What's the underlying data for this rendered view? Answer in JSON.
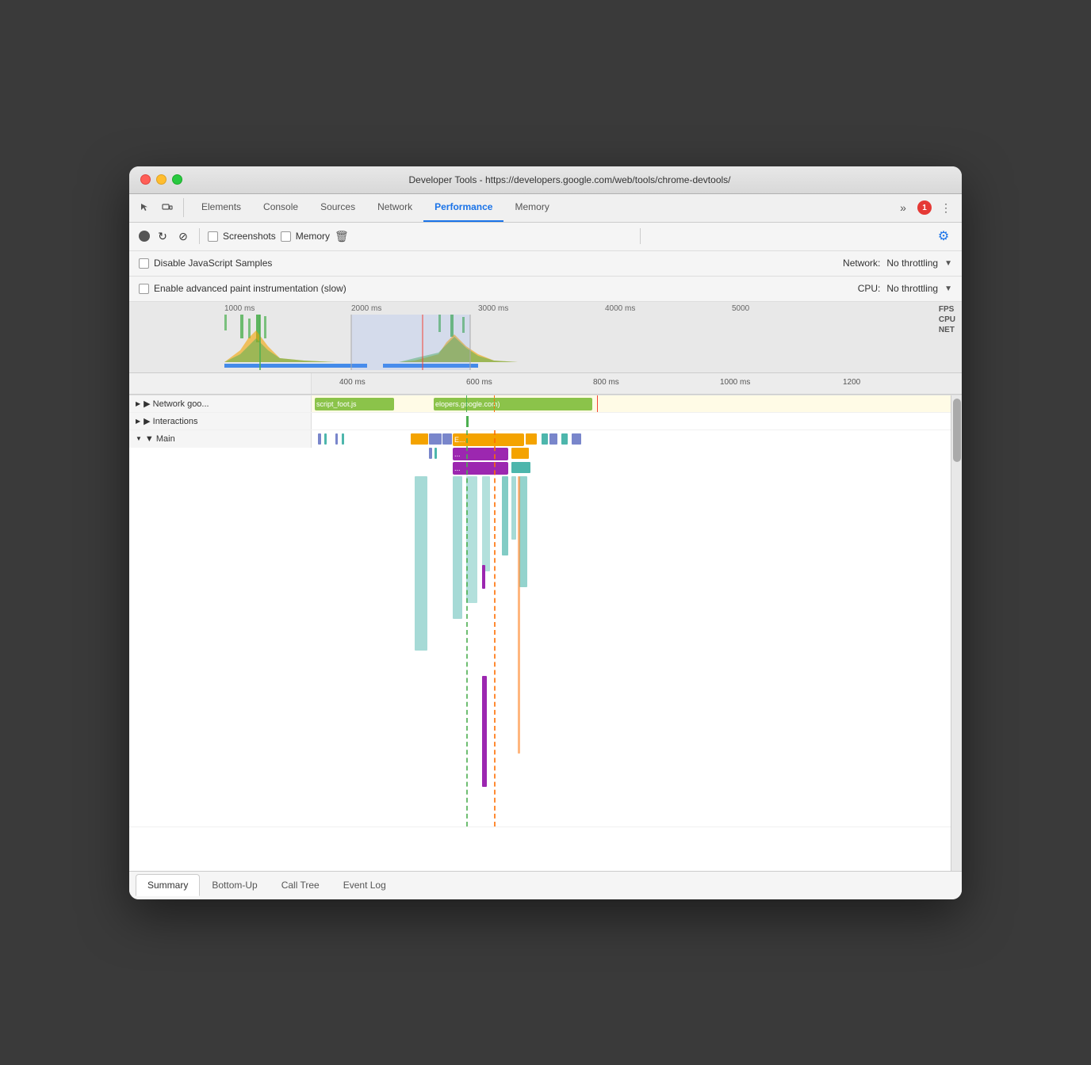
{
  "window": {
    "title": "Developer Tools - https://developers.google.com/web/tools/chrome-devtools/"
  },
  "tabs": {
    "items": [
      {
        "label": "Elements",
        "active": false
      },
      {
        "label": "Console",
        "active": false
      },
      {
        "label": "Sources",
        "active": false
      },
      {
        "label": "Network",
        "active": false
      },
      {
        "label": "Performance",
        "active": true
      },
      {
        "label": "Memory",
        "active": false
      }
    ],
    "error_count": "1"
  },
  "toolbar": {
    "screenshots_label": "Screenshots",
    "memory_label": "Memory"
  },
  "settings": {
    "disable_js_samples": "Disable JavaScript Samples",
    "enable_paint": "Enable advanced paint instrumentation (slow)",
    "network_label": "Network:",
    "network_value": "No throttling",
    "cpu_label": "CPU:",
    "cpu_value": "No throttling"
  },
  "timeline": {
    "overview_marks": [
      "1000 ms",
      "2000 ms",
      "3000 ms",
      "4000 ms",
      "5000"
    ],
    "detail_marks": [
      "400 ms",
      "600 ms",
      "800 ms",
      "1000 ms",
      "1200"
    ],
    "labels": [
      "FPS",
      "CPU",
      "NET"
    ]
  },
  "flame": {
    "network_label": "▶ Network goo...",
    "network_items": [
      "script_foot.js",
      "elopers.google.com)"
    ],
    "interactions_label": "▶ Interactions",
    "main_label": "▼ Main",
    "blocks": [
      {
        "label": "E...",
        "color": "#f4a300"
      },
      {
        "label": "(...",
        "color": "#9c27b0"
      },
      {
        "label": "(...",
        "color": "#9c27b0"
      }
    ]
  },
  "bottom_tabs": {
    "items": [
      {
        "label": "Summary",
        "active": true
      },
      {
        "label": "Bottom-Up",
        "active": false
      },
      {
        "label": "Call Tree",
        "active": false
      },
      {
        "label": "Event Log",
        "active": false
      }
    ]
  }
}
